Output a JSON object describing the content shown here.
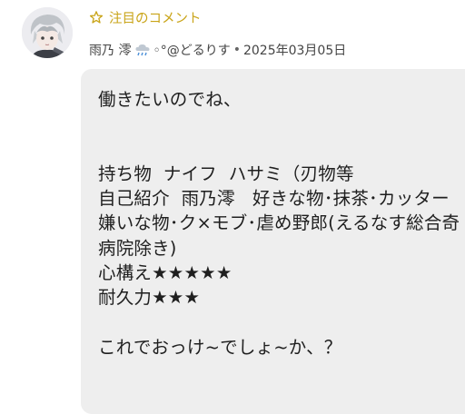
{
  "comment_card": {
    "badge_label": "注目のコメント",
    "author": {
      "name_before_icon": "雨乃 澪",
      "name_after_icon": "◦°@どるりす"
    },
    "separator": "•",
    "date": "2025年03月05日",
    "body": "働きたいのでね、\n\n\n持ち物  ナイフ  ハサミ（刃物等\n自己紹介  雨乃澪   好きな物･抹茶･カッター  嫌いな物･ク×モブ･虐め野郎(えるなす総合奇病院除き)\n心構え★★★★★\n耐久力★★★\n\nこれでおっけ~でしょ~か、？"
  },
  "icons": {
    "badge": "star-outline-icon",
    "weather": "rain-cloud-icon"
  },
  "colors": {
    "badge": "#c9a418",
    "bubble": "#eeeeee",
    "text": "#1f1f1f"
  }
}
